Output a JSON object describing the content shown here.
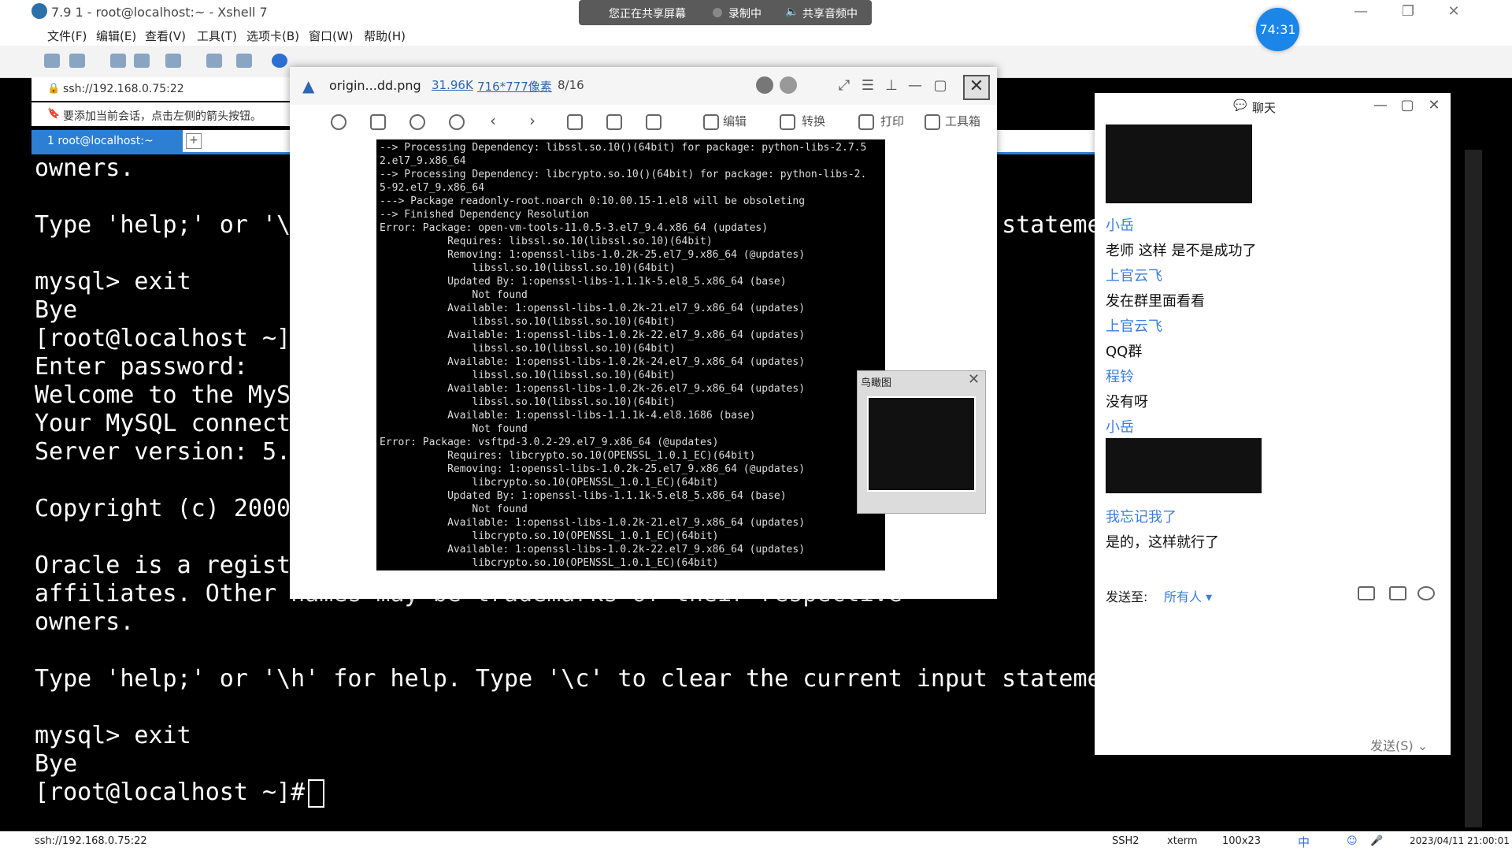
{
  "window": {
    "title": "7.9 1 - root@localhost:~ - Xshell 7"
  },
  "menu": [
    "文件(F)",
    "编辑(E)",
    "查看(V)",
    "工具(T)",
    "选项卡(B)",
    "窗口(W)",
    "帮助(H)"
  ],
  "session": {
    "address": "ssh://192.168.0.75:22",
    "hint": "要添加当前会话，点击左侧的箭头按钮。",
    "tab_label": "1 root@localhost:~",
    "tab_add": "+"
  },
  "terminal": {
    "lines": [
      "owners.",
      "",
      "Type 'help;' or '\\h' for help. Type '\\c' to clear the current input stateme",
      "",
      "mysql> exit",
      "Bye",
      "[root@localhost ~]",
      "Enter password:",
      "Welcome to the MyS",
      "Your MySQL connect",
      "Server version: 5.",
      "",
      "Copyright (c) 2000",
      "",
      "Oracle is a regist",
      "affiliates. Other names may be trademarks of their respective",
      "owners.",
      "",
      "Type 'help;' or '\\h' for help. Type '\\c' to clear the current input stateme",
      "",
      "mysql> exit",
      "Bye",
      "[root@localhost ~]#"
    ]
  },
  "sharing": {
    "status": "您正在共享屏幕",
    "recording": "录制中",
    "audio": "共享音频中",
    "timer": "74:31"
  },
  "viewer": {
    "filename": "origin...dd.png",
    "filesize": "31.96K",
    "dimensions": "716*777像素",
    "position": "8/16",
    "tools": {
      "edit": "编辑",
      "convert": "转换",
      "print": "打印",
      "toolbox": "工具箱"
    },
    "navigator_title": "鸟瞰图",
    "log": [
      "--> Processing Dependency: libssl.so.10()(64bit) for package: python-libs-2.7.5",
      "2.el7_9.x86_64",
      "--> Processing Dependency: libcrypto.so.10()(64bit) for package: python-libs-2.",
      "5-92.el7_9.x86_64",
      "---> Package readonly-root.noarch 0:10.00.15-1.el8 will be obsoleting",
      "--> Finished Dependency Resolution",
      "Error: Package: open-vm-tools-11.0.5-3.el7_9.4.x86_64 (updates)",
      "           Requires: libssl.so.10(libssl.so.10)(64bit)",
      "           Removing: 1:openssl-libs-1.0.2k-25.el7_9.x86_64 (@updates)",
      "               libssl.so.10(libssl.so.10)(64bit)",
      "           Updated By: 1:openssl-libs-1.1.1k-5.el8_5.x86_64 (base)",
      "               Not found",
      "           Available: 1:openssl-libs-1.0.2k-21.el7_9.x86_64 (updates)",
      "               libssl.so.10(libssl.so.10)(64bit)",
      "           Available: 1:openssl-libs-1.0.2k-22.el7_9.x86_64 (updates)",
      "               libssl.so.10(libssl.so.10)(64bit)",
      "           Available: 1:openssl-libs-1.0.2k-24.el7_9.x86_64 (updates)",
      "               libssl.so.10(libssl.so.10)(64bit)",
      "           Available: 1:openssl-libs-1.0.2k-26.el7_9.x86_64 (updates)",
      "               libssl.so.10(libssl.so.10)(64bit)",
      "           Available: 1:openssl-libs-1.1.1k-4.el8.1686 (base)",
      "               Not found",
      "Error: Package: vsftpd-3.0.2-29.el7_9.x86_64 (@updates)",
      "           Requires: libcrypto.so.10(OPENSSL_1.0.1_EC)(64bit)",
      "           Removing: 1:openssl-libs-1.0.2k-25.el7_9.x86_64 (@updates)",
      "               libcrypto.so.10(OPENSSL_1.0.1_EC)(64bit)",
      "           Updated By: 1:openssl-libs-1.1.1k-5.el8_5.x86_64 (base)",
      "               Not found",
      "           Available: 1:openssl-libs-1.0.2k-21.el7_9.x86_64 (updates)",
      "               libcrypto.so.10(OPENSSL_1.0.1_EC)(64bit)",
      "           Available: 1:openssl-libs-1.0.2k-22.el7_9.x86_64 (updates)",
      "               libcrypto.so.10(OPENSSL_1.0.1_EC)(64bit)"
    ]
  },
  "chat": {
    "title": "聊天",
    "messages": [
      {
        "name": "小岳",
        "text": "老师 这样 是不是成功了"
      },
      {
        "name": "上官云飞",
        "text": "发在群里面看看"
      },
      {
        "name": "上官云飞",
        "text": "QQ群"
      },
      {
        "name": "程铃",
        "text": "没有呀"
      },
      {
        "name": "小岳",
        "text": ""
      },
      {
        "name": "我忘记我了",
        "text": "是的，这样就行了"
      }
    ],
    "send_to_label": "发送至:",
    "send_to_value": "所有人",
    "send_button": "发送(S)"
  },
  "status": {
    "address": "ssh://192.168.0.75:22",
    "protocol": "SSH2",
    "term": "xterm",
    "size": "100x23",
    "ime": "中",
    "datetime": "2023/04/11 21:00:01"
  },
  "colors": {
    "accent": "#2d7fd3",
    "chat_name": "#3b7ddd",
    "timer": "#1b86e8"
  }
}
